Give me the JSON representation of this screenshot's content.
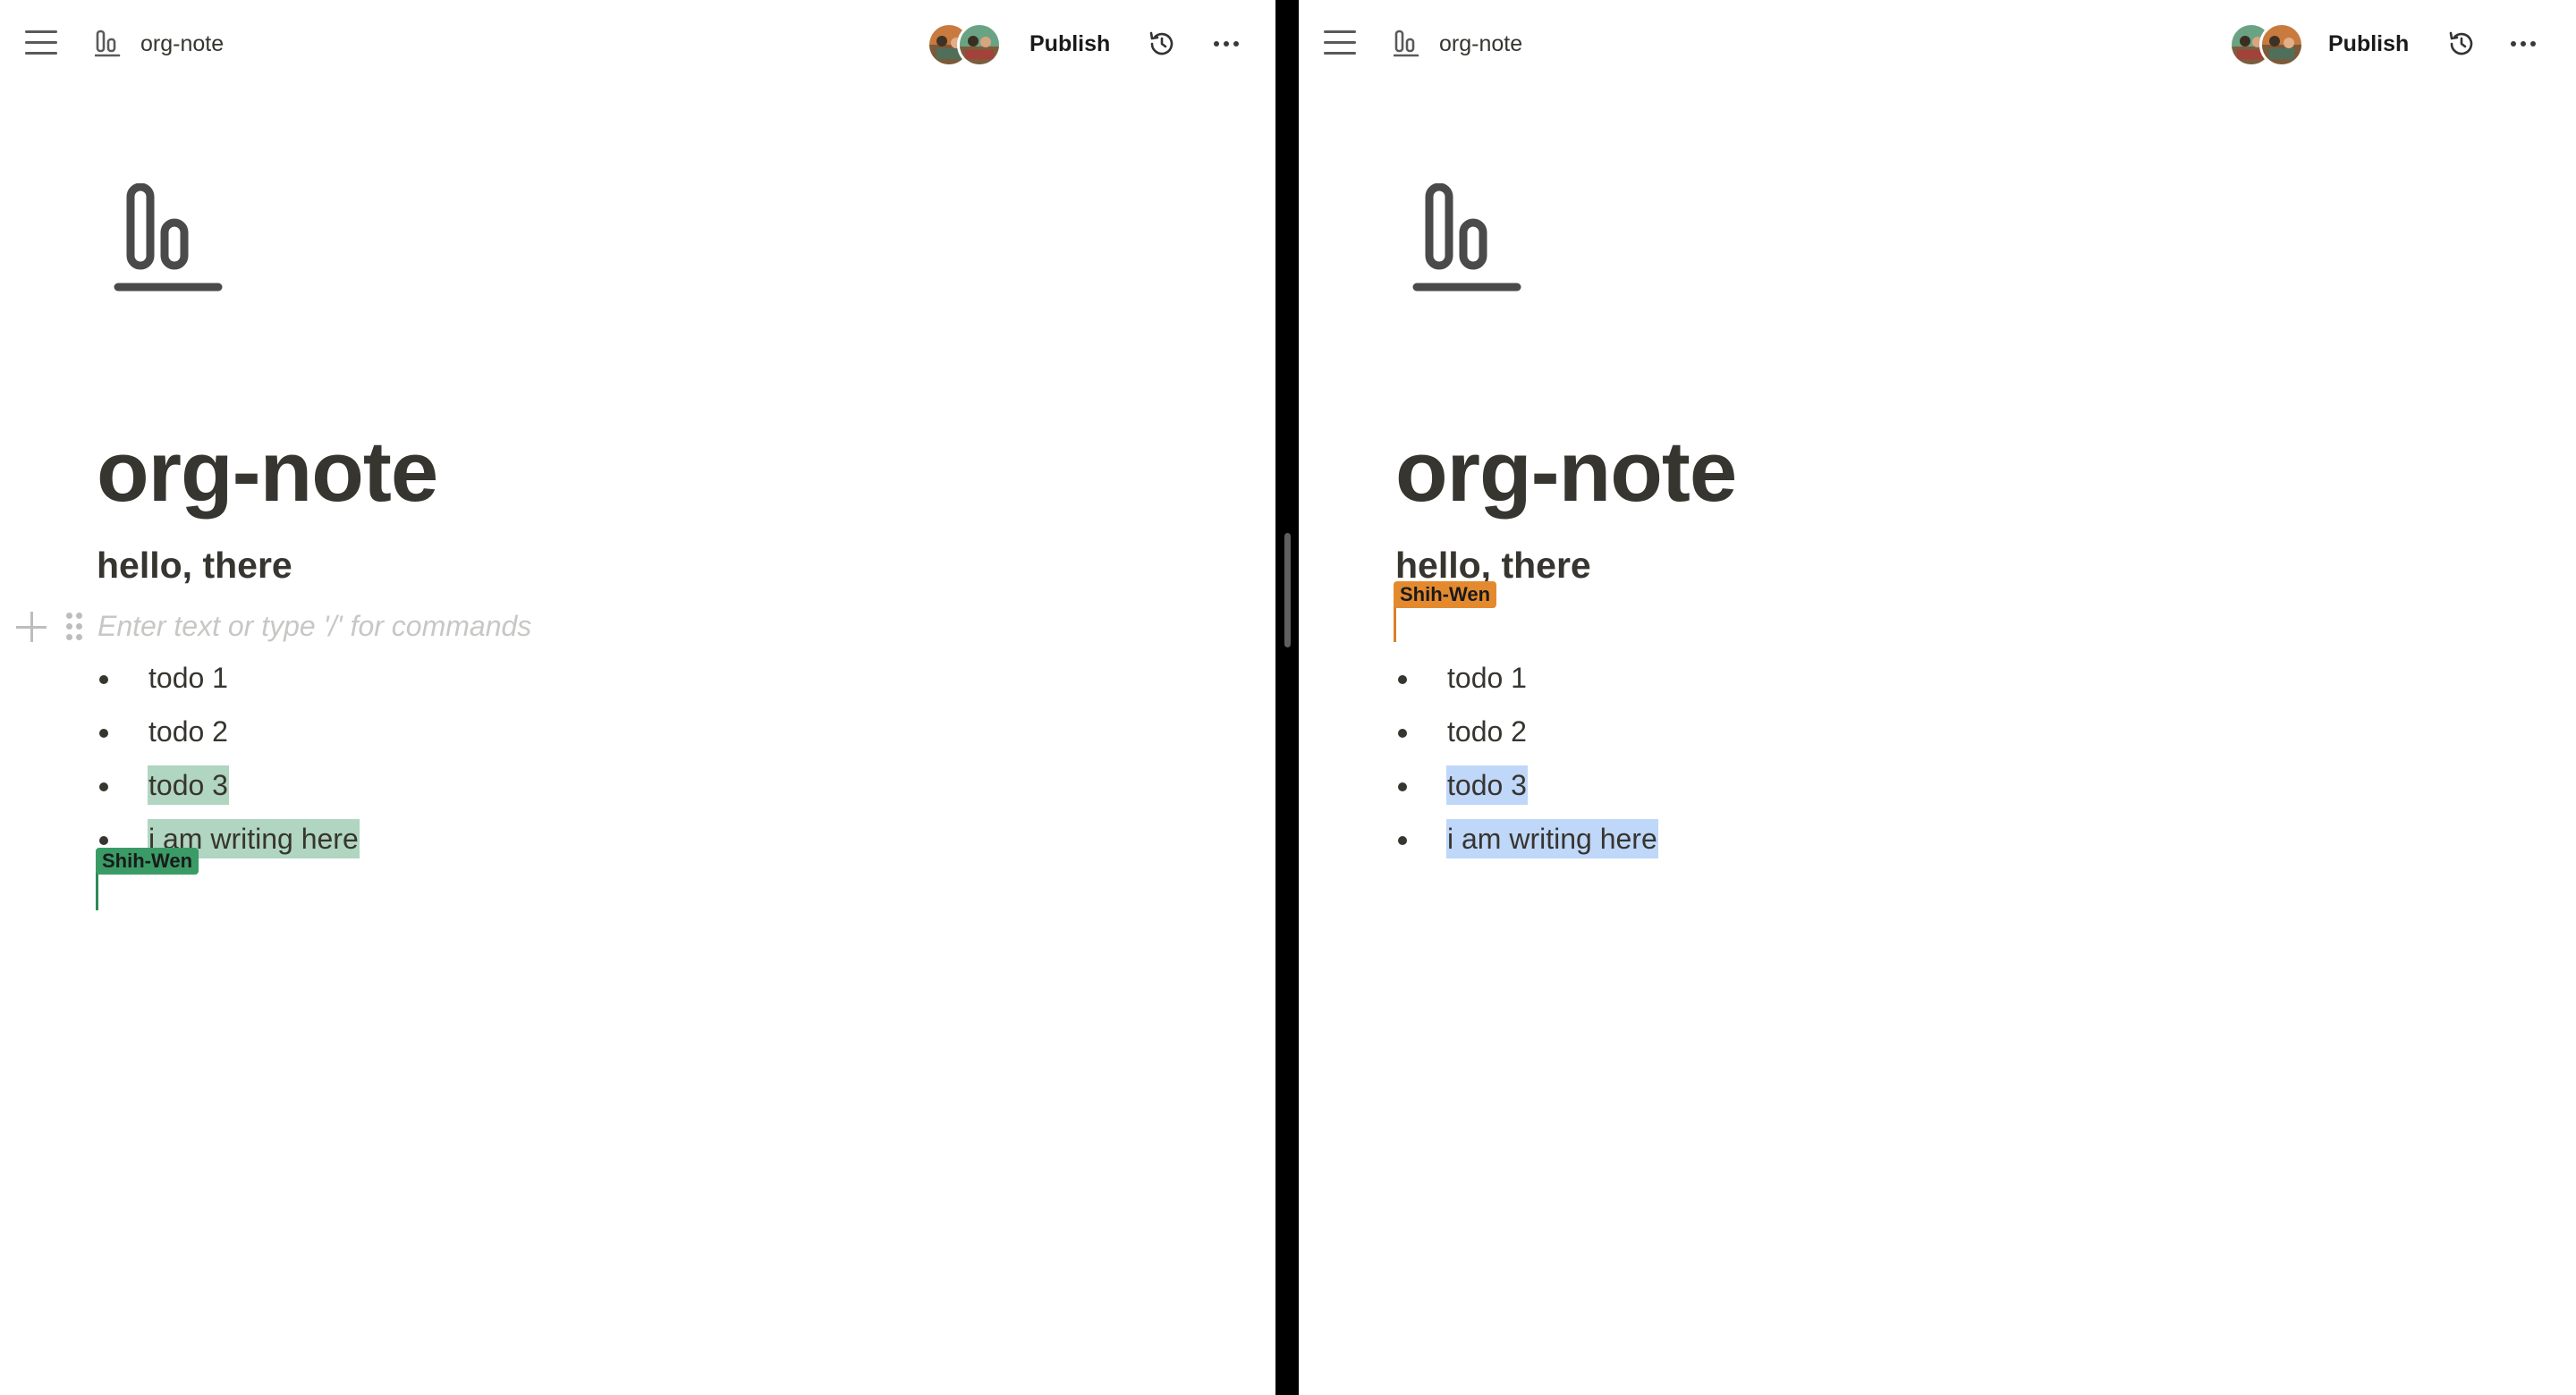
{
  "doc_icon": "align-bottom-icon",
  "panes": [
    {
      "side": "left",
      "topbar": {
        "menu_icon": "hamburger-menu-icon",
        "title": "org-note",
        "publish_label": "Publish",
        "history_icon": "history-icon",
        "more_icon": "more-options-icon"
      },
      "page_title": "org-note",
      "heading": "hello, there",
      "placeholder": "Enter text or type '/' for commands",
      "list": [
        {
          "text": "todo 1",
          "highlight": false
        },
        {
          "text": "todo 2",
          "highlight": false
        },
        {
          "text": "todo 3",
          "highlight": true
        },
        {
          "text": "i am writing here",
          "highlight": true
        }
      ],
      "collaborator_cursor": {
        "name": "Shih-Wen",
        "color": "#3a9b66"
      }
    },
    {
      "side": "right",
      "topbar": {
        "menu_icon": "hamburger-menu-icon",
        "title": "org-note",
        "publish_label": "Publish",
        "history_icon": "history-icon",
        "more_icon": "more-options-icon"
      },
      "page_title": "org-note",
      "heading": "hello, there",
      "list": [
        {
          "text": "todo 1",
          "highlight": false
        },
        {
          "text": "todo 2",
          "highlight": false
        },
        {
          "text": "todo 3",
          "highlight": true
        },
        {
          "text": "i am writing here",
          "highlight": true
        }
      ],
      "collaborator_cursor": {
        "name": "Shih-Wen",
        "color": "#e48a2e"
      }
    }
  ],
  "colors": {
    "text": "#37352f",
    "selection_left": "#b0d5c1",
    "selection_right": "#bfd7f9",
    "cursor_green": "#3a9b66",
    "cursor_orange": "#e48a2e",
    "divider": "#000000"
  }
}
